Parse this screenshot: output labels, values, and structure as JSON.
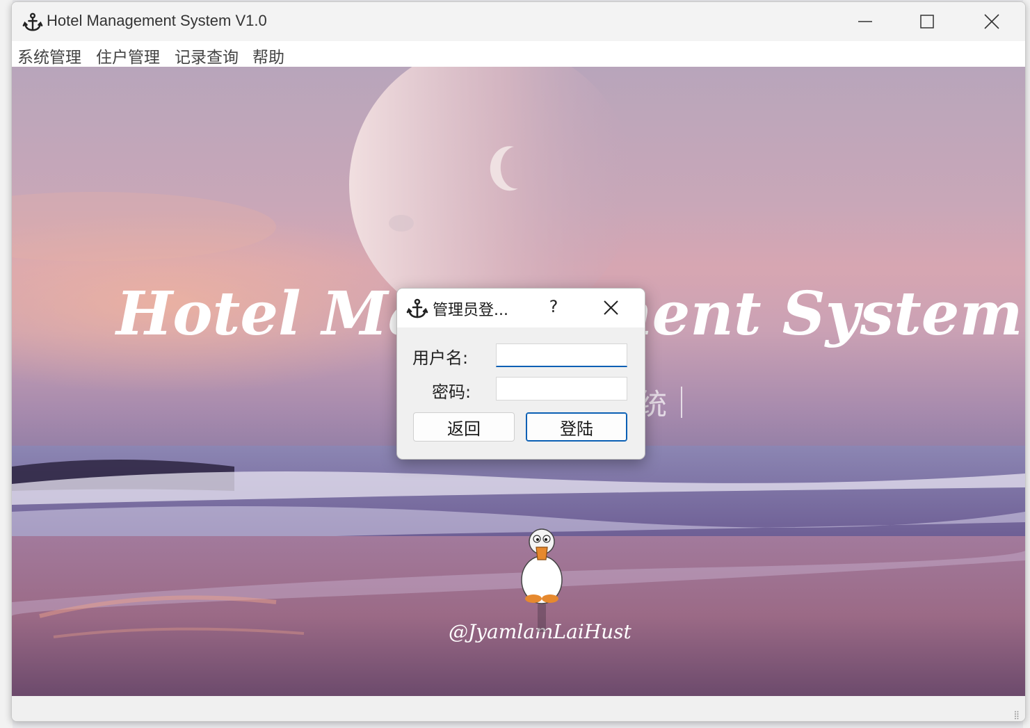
{
  "window": {
    "title": "Hotel Management System V1.0",
    "minimize_icon": "minimize-icon",
    "maximize_icon": "maximize-icon",
    "close_icon": "close-icon"
  },
  "menu": {
    "items": [
      "系统管理",
      "住户管理",
      "记录查询",
      "帮助"
    ]
  },
  "background": {
    "headline": "Hotel Management System",
    "subtitle_visible_fragment": "统",
    "signature": "@JyamlamLaiHust",
    "colors": {
      "sky_top": "#b8a5bb",
      "horizon": "#d7a6b2",
      "sea": "#7a6a99",
      "sand": "#9a6c88"
    }
  },
  "dialog": {
    "title": "管理员登...",
    "help": "?",
    "username_label": "用户名:",
    "password_label": "密码:",
    "username_value": "",
    "password_value": "",
    "back_button": "返回",
    "login_button": "登陆",
    "accent_color": "#0a5fb4"
  }
}
